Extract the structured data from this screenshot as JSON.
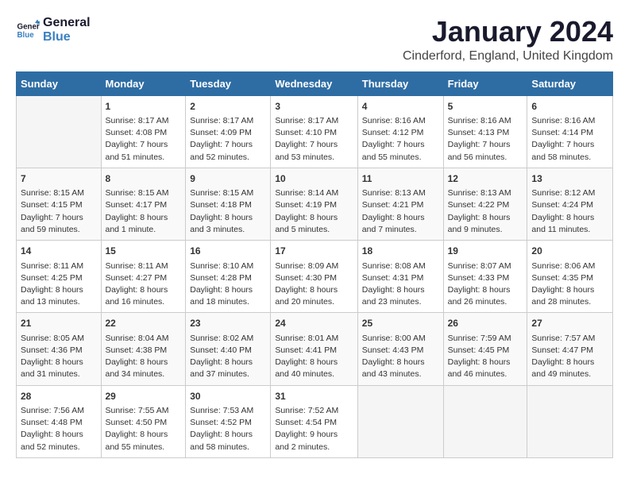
{
  "header": {
    "logo_line1": "General",
    "logo_line2": "Blue",
    "month": "January 2024",
    "location": "Cinderford, England, United Kingdom"
  },
  "days_of_week": [
    "Sunday",
    "Monday",
    "Tuesday",
    "Wednesday",
    "Thursday",
    "Friday",
    "Saturday"
  ],
  "weeks": [
    [
      {
        "day": "",
        "sunrise": "",
        "sunset": "",
        "daylight": "",
        "empty": true
      },
      {
        "day": "1",
        "sunrise": "Sunrise: 8:17 AM",
        "sunset": "Sunset: 4:08 PM",
        "daylight": "Daylight: 7 hours and 51 minutes."
      },
      {
        "day": "2",
        "sunrise": "Sunrise: 8:17 AM",
        "sunset": "Sunset: 4:09 PM",
        "daylight": "Daylight: 7 hours and 52 minutes."
      },
      {
        "day": "3",
        "sunrise": "Sunrise: 8:17 AM",
        "sunset": "Sunset: 4:10 PM",
        "daylight": "Daylight: 7 hours and 53 minutes."
      },
      {
        "day": "4",
        "sunrise": "Sunrise: 8:16 AM",
        "sunset": "Sunset: 4:12 PM",
        "daylight": "Daylight: 7 hours and 55 minutes."
      },
      {
        "day": "5",
        "sunrise": "Sunrise: 8:16 AM",
        "sunset": "Sunset: 4:13 PM",
        "daylight": "Daylight: 7 hours and 56 minutes."
      },
      {
        "day": "6",
        "sunrise": "Sunrise: 8:16 AM",
        "sunset": "Sunset: 4:14 PM",
        "daylight": "Daylight: 7 hours and 58 minutes."
      }
    ],
    [
      {
        "day": "7",
        "sunrise": "Sunrise: 8:15 AM",
        "sunset": "Sunset: 4:15 PM",
        "daylight": "Daylight: 7 hours and 59 minutes."
      },
      {
        "day": "8",
        "sunrise": "Sunrise: 8:15 AM",
        "sunset": "Sunset: 4:17 PM",
        "daylight": "Daylight: 8 hours and 1 minute."
      },
      {
        "day": "9",
        "sunrise": "Sunrise: 8:15 AM",
        "sunset": "Sunset: 4:18 PM",
        "daylight": "Daylight: 8 hours and 3 minutes."
      },
      {
        "day": "10",
        "sunrise": "Sunrise: 8:14 AM",
        "sunset": "Sunset: 4:19 PM",
        "daylight": "Daylight: 8 hours and 5 minutes."
      },
      {
        "day": "11",
        "sunrise": "Sunrise: 8:13 AM",
        "sunset": "Sunset: 4:21 PM",
        "daylight": "Daylight: 8 hours and 7 minutes."
      },
      {
        "day": "12",
        "sunrise": "Sunrise: 8:13 AM",
        "sunset": "Sunset: 4:22 PM",
        "daylight": "Daylight: 8 hours and 9 minutes."
      },
      {
        "day": "13",
        "sunrise": "Sunrise: 8:12 AM",
        "sunset": "Sunset: 4:24 PM",
        "daylight": "Daylight: 8 hours and 11 minutes."
      }
    ],
    [
      {
        "day": "14",
        "sunrise": "Sunrise: 8:11 AM",
        "sunset": "Sunset: 4:25 PM",
        "daylight": "Daylight: 8 hours and 13 minutes."
      },
      {
        "day": "15",
        "sunrise": "Sunrise: 8:11 AM",
        "sunset": "Sunset: 4:27 PM",
        "daylight": "Daylight: 8 hours and 16 minutes."
      },
      {
        "day": "16",
        "sunrise": "Sunrise: 8:10 AM",
        "sunset": "Sunset: 4:28 PM",
        "daylight": "Daylight: 8 hours and 18 minutes."
      },
      {
        "day": "17",
        "sunrise": "Sunrise: 8:09 AM",
        "sunset": "Sunset: 4:30 PM",
        "daylight": "Daylight: 8 hours and 20 minutes."
      },
      {
        "day": "18",
        "sunrise": "Sunrise: 8:08 AM",
        "sunset": "Sunset: 4:31 PM",
        "daylight": "Daylight: 8 hours and 23 minutes."
      },
      {
        "day": "19",
        "sunrise": "Sunrise: 8:07 AM",
        "sunset": "Sunset: 4:33 PM",
        "daylight": "Daylight: 8 hours and 26 minutes."
      },
      {
        "day": "20",
        "sunrise": "Sunrise: 8:06 AM",
        "sunset": "Sunset: 4:35 PM",
        "daylight": "Daylight: 8 hours and 28 minutes."
      }
    ],
    [
      {
        "day": "21",
        "sunrise": "Sunrise: 8:05 AM",
        "sunset": "Sunset: 4:36 PM",
        "daylight": "Daylight: 8 hours and 31 minutes."
      },
      {
        "day": "22",
        "sunrise": "Sunrise: 8:04 AM",
        "sunset": "Sunset: 4:38 PM",
        "daylight": "Daylight: 8 hours and 34 minutes."
      },
      {
        "day": "23",
        "sunrise": "Sunrise: 8:02 AM",
        "sunset": "Sunset: 4:40 PM",
        "daylight": "Daylight: 8 hours and 37 minutes."
      },
      {
        "day": "24",
        "sunrise": "Sunrise: 8:01 AM",
        "sunset": "Sunset: 4:41 PM",
        "daylight": "Daylight: 8 hours and 40 minutes."
      },
      {
        "day": "25",
        "sunrise": "Sunrise: 8:00 AM",
        "sunset": "Sunset: 4:43 PM",
        "daylight": "Daylight: 8 hours and 43 minutes."
      },
      {
        "day": "26",
        "sunrise": "Sunrise: 7:59 AM",
        "sunset": "Sunset: 4:45 PM",
        "daylight": "Daylight: 8 hours and 46 minutes."
      },
      {
        "day": "27",
        "sunrise": "Sunrise: 7:57 AM",
        "sunset": "Sunset: 4:47 PM",
        "daylight": "Daylight: 8 hours and 49 minutes."
      }
    ],
    [
      {
        "day": "28",
        "sunrise": "Sunrise: 7:56 AM",
        "sunset": "Sunset: 4:48 PM",
        "daylight": "Daylight: 8 hours and 52 minutes."
      },
      {
        "day": "29",
        "sunrise": "Sunrise: 7:55 AM",
        "sunset": "Sunset: 4:50 PM",
        "daylight": "Daylight: 8 hours and 55 minutes."
      },
      {
        "day": "30",
        "sunrise": "Sunrise: 7:53 AM",
        "sunset": "Sunset: 4:52 PM",
        "daylight": "Daylight: 8 hours and 58 minutes."
      },
      {
        "day": "31",
        "sunrise": "Sunrise: 7:52 AM",
        "sunset": "Sunset: 4:54 PM",
        "daylight": "Daylight: 9 hours and 2 minutes."
      },
      {
        "day": "",
        "sunrise": "",
        "sunset": "",
        "daylight": "",
        "empty": true
      },
      {
        "day": "",
        "sunrise": "",
        "sunset": "",
        "daylight": "",
        "empty": true
      },
      {
        "day": "",
        "sunrise": "",
        "sunset": "",
        "daylight": "",
        "empty": true
      }
    ]
  ]
}
